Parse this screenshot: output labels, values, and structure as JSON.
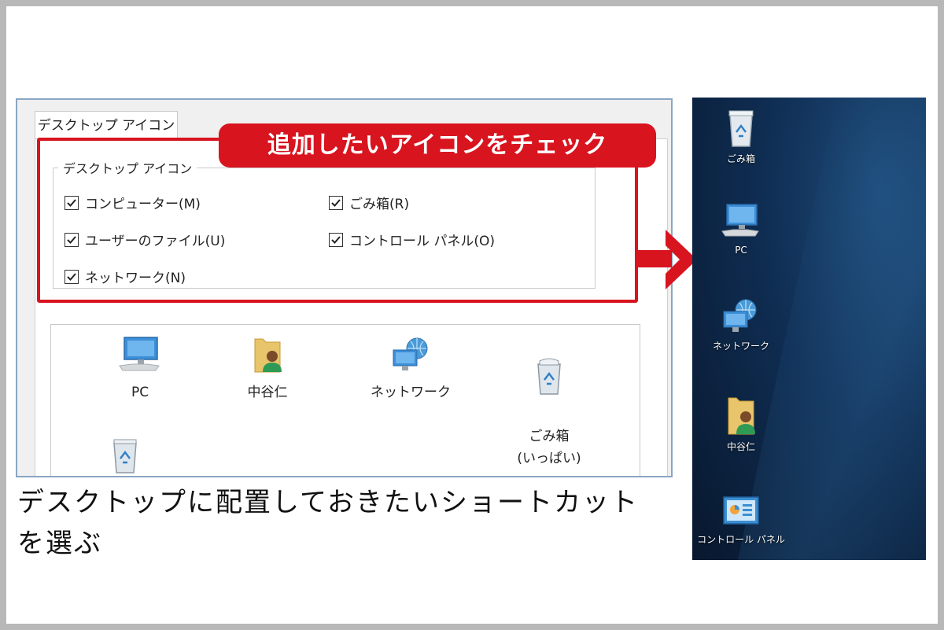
{
  "dialog": {
    "tab_label": "デスクトップ アイコン",
    "group_label": "デスクトップ アイコン",
    "checkboxes": [
      {
        "label": "コンピューター(M)",
        "checked": true
      },
      {
        "label": "ごみ箱(R)",
        "checked": true
      },
      {
        "label": "ユーザーのファイル(U)",
        "checked": true
      },
      {
        "label": "コントロール パネル(O)",
        "checked": true
      },
      {
        "label": "ネットワーク(N)",
        "checked": true
      }
    ],
    "preview_items": [
      {
        "label": "PC",
        "icon": "monitor-icon"
      },
      {
        "label": "中谷仁",
        "icon": "user-folder-icon"
      },
      {
        "label": "ネットワーク",
        "icon": "network-icon"
      },
      {
        "label": "ごみ箱\n(いっぱい)",
        "icon": "recycle-bin-full-icon"
      }
    ]
  },
  "callout": {
    "text": "追加したいアイコンをチェック",
    "color": "#d8141f"
  },
  "caption": "デスクトップに配置しておきたいショートカットを選ぶ",
  "desktop": {
    "icons": [
      {
        "label": "ごみ箱",
        "icon": "recycle-bin-icon"
      },
      {
        "label": "PC",
        "icon": "monitor-icon"
      },
      {
        "label": "ネットワーク",
        "icon": "network-icon"
      },
      {
        "label": "中谷仁",
        "icon": "user-folder-icon"
      },
      {
        "label": "コントロール パネル",
        "icon": "control-panel-icon"
      }
    ]
  }
}
